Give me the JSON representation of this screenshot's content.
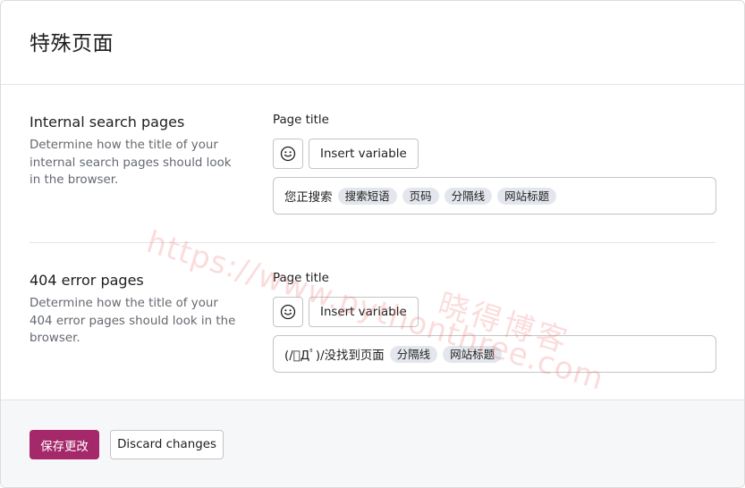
{
  "header": {
    "title": "特殊页面"
  },
  "sections": [
    {
      "heading": "Internal search pages",
      "description": "Determine how the title of your internal search pages should look in the browser.",
      "field_label": "Page title",
      "insert_variable_label": "Insert variable",
      "title_prefix": "您正搜索",
      "chips": [
        "搜索短语",
        "页码",
        "分隔线",
        "网站标题"
      ]
    },
    {
      "heading": "404 error pages",
      "description": "Determine how the title of your 404 error pages should look in the browser.",
      "field_label": "Page title",
      "insert_variable_label": "Insert variable",
      "title_prefix": "(/ﾟДﾟ)/没找到页面",
      "chips": [
        "分隔线",
        "网站标题"
      ]
    }
  ],
  "footer": {
    "save_label": "保存更改",
    "discard_label": "Discard changes"
  },
  "watermark": {
    "url": "https://www.pythonthree.com",
    "name": "晓得博客"
  },
  "colors": {
    "save_button": "#a4286a",
    "chip_bg": "#e3e7ed",
    "footer_bg": "#f6f7f8"
  }
}
